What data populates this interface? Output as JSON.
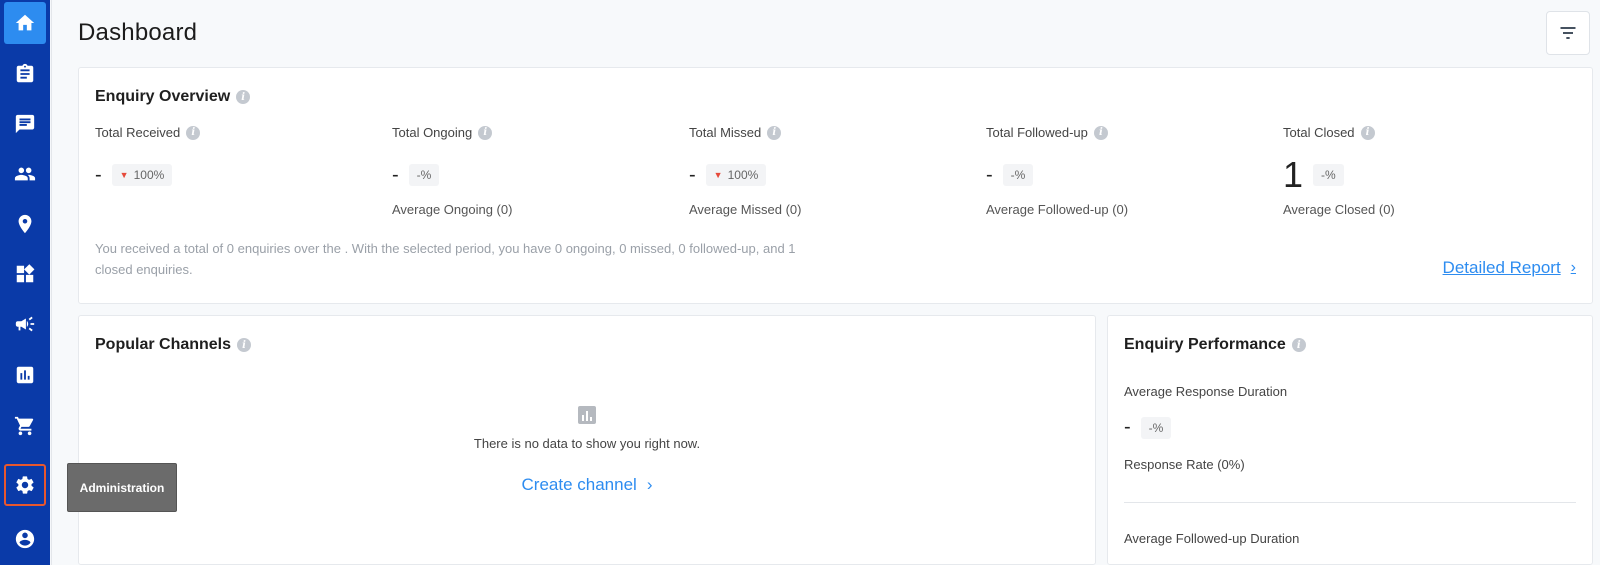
{
  "sidebar": {
    "tooltip": "Administration"
  },
  "page": {
    "title": "Dashboard"
  },
  "overview": {
    "title": "Enquiry Overview",
    "stats": [
      {
        "label": "Total Received",
        "value": "-",
        "badge": "100%",
        "avg": ""
      },
      {
        "label": "Total Ongoing",
        "value": "-",
        "badge": "-%",
        "avg": "Average Ongoing (0)"
      },
      {
        "label": "Total Missed",
        "value": "-",
        "badge": "100%",
        "avg": "Average Missed (0)"
      },
      {
        "label": "Total Followed-up",
        "value": "-",
        "badge": "-%",
        "avg": "Average Followed-up (0)"
      },
      {
        "label": "Total Closed",
        "value": "1",
        "badge": "-%",
        "avg": "Average Closed (0)"
      }
    ],
    "summary": "You received a total of 0 enquiries over the . With the selected period, you have 0 ongoing, 0 missed, 0 followed-up, and 1 closed enquiries.",
    "detailed_report": "Detailed Report"
  },
  "channels": {
    "title": "Popular Channels",
    "empty_text": "There is no data to show you right now.",
    "create_link": "Create channel"
  },
  "performance": {
    "title": "Enquiry Performance",
    "avg_response_label": "Average Response Duration",
    "avg_response_value": "-",
    "avg_response_badge": "-%",
    "response_rate": "Response Rate (0%)",
    "avg_followup_label": "Average Followed-up Duration"
  },
  "colors": {
    "sidebar": "#0a3aa8",
    "accent": "#2d8cf0",
    "highlight": "#e8572e",
    "down": "#e64a3b"
  }
}
